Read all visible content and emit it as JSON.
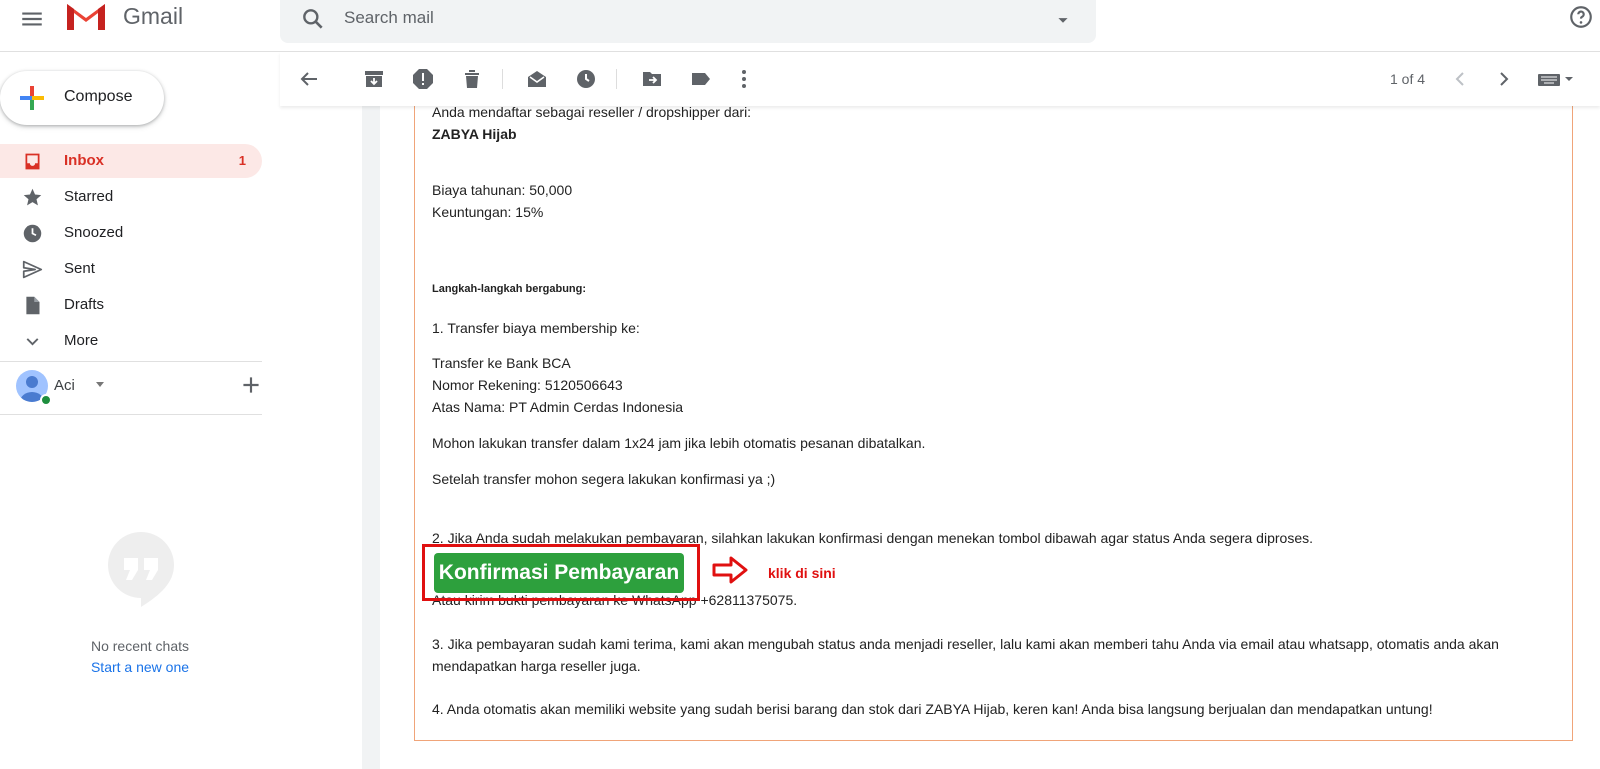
{
  "header": {
    "app_name": "Gmail",
    "search_placeholder": "Search mail"
  },
  "sidebar": {
    "compose_label": "Compose",
    "items": [
      {
        "label": "Inbox",
        "count": "1",
        "icon": "inbox-icon"
      },
      {
        "label": "Starred",
        "icon": "star-icon"
      },
      {
        "label": "Snoozed",
        "icon": "clock-icon"
      },
      {
        "label": "Sent",
        "icon": "send-icon"
      },
      {
        "label": "Drafts",
        "icon": "draft-icon"
      },
      {
        "label": "More",
        "icon": "chevron-down-icon"
      }
    ],
    "account_name": "Aci",
    "no_chats": "No recent chats",
    "start_new": "Start a new one"
  },
  "toolbar": {
    "pager": "1 of 4"
  },
  "email": {
    "intro": "Anda mendaftar sebagai reseller / dropshipper dari:",
    "store": "ZABYA Hijab",
    "fee": "Biaya tahunan: 50,000",
    "profit": "Keuntungan: 15%",
    "steps_title": "Langkah-langkah bergabung:",
    "step1": "1. Transfer biaya membership ke:",
    "bank": "Transfer ke Bank BCA",
    "account_no": "Nomor Rekening: 5120506643",
    "account_name": "Atas Nama: PT Admin Cerdas Indonesia",
    "deadline": "Mohon lakukan transfer dalam 1x24 jam jika lebih otomatis pesanan dibatalkan.",
    "after_transfer": "Setelah transfer mohon segera lakukan konfirmasi ya ;)",
    "step2": "2. Jika Anda sudah melakukan pembayaran, silahkan lakukan konfirmasi dengan menekan tombol dibawah agar status Anda segera diproses.",
    "confirm_button": "Konfirmasi Pembayaran",
    "whatsapp": "Atau kirim bukti pembayaran ke WhatsApp +62811375075.",
    "step3": "3. Jika pembayaran sudah kami terima, kami akan mengubah status anda menjadi reseller, lalu kami akan memberi tahu Anda via email atau whatsapp, otomatis anda akan mendapatkan harga reseller juga.",
    "step4": "4. Anda otomatis akan memiliki website yang sudah berisi barang dan stok dari ZABYA Hijab, keren kan! Anda bisa langsung berjualan dan mendapatkan untung!"
  },
  "annotation": {
    "text": "klik di sini",
    "color": "#e01010"
  },
  "colors": {
    "accent_red": "#d93025",
    "button_green": "#2da03d",
    "email_border": "#f0a479"
  }
}
